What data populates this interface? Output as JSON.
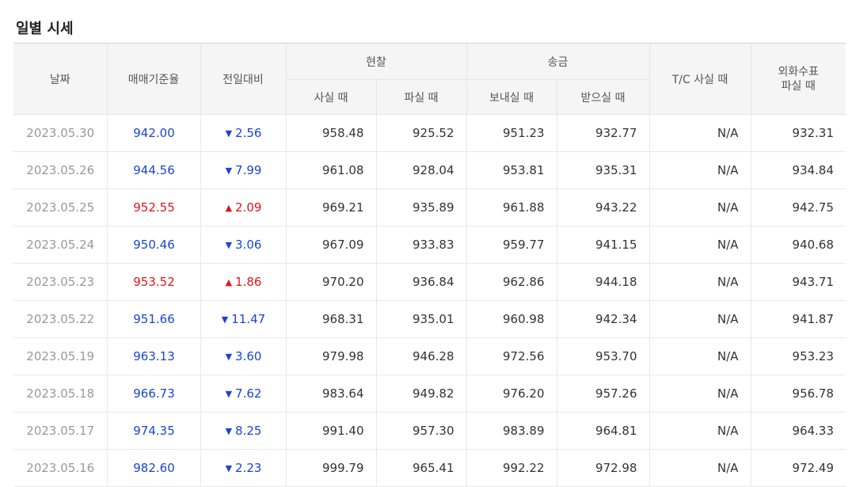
{
  "title": "일별 시세",
  "headers": {
    "date": "날짜",
    "base_rate": "매매기준율",
    "change": "전일대비",
    "cash": "현찰",
    "cash_buy": "사실 때",
    "cash_sell": "파실 때",
    "remit": "송금",
    "remit_send": "보내실 때",
    "remit_receive": "받으실 때",
    "tc_buy": "T/C 사실 때",
    "check_line1": "외화수표",
    "check_line2": "파실 때"
  },
  "colors": {
    "up": "#e3141b",
    "down": "#1a45d1"
  },
  "rows": [
    {
      "date": "2023.05.30",
      "base": "942.00",
      "dir": "down",
      "arrow": "▼",
      "change": "2.56",
      "cash_buy": "958.48",
      "cash_sell": "925.52",
      "send": "951.23",
      "receive": "932.77",
      "tc": "N/A",
      "check": "932.31"
    },
    {
      "date": "2023.05.26",
      "base": "944.56",
      "dir": "down",
      "arrow": "▼",
      "change": "7.99",
      "cash_buy": "961.08",
      "cash_sell": "928.04",
      "send": "953.81",
      "receive": "935.31",
      "tc": "N/A",
      "check": "934.84"
    },
    {
      "date": "2023.05.25",
      "base": "952.55",
      "dir": "up",
      "arrow": "▲",
      "change": "2.09",
      "cash_buy": "969.21",
      "cash_sell": "935.89",
      "send": "961.88",
      "receive": "943.22",
      "tc": "N/A",
      "check": "942.75"
    },
    {
      "date": "2023.05.24",
      "base": "950.46",
      "dir": "down",
      "arrow": "▼",
      "change": "3.06",
      "cash_buy": "967.09",
      "cash_sell": "933.83",
      "send": "959.77",
      "receive": "941.15",
      "tc": "N/A",
      "check": "940.68"
    },
    {
      "date": "2023.05.23",
      "base": "953.52",
      "dir": "up",
      "arrow": "▲",
      "change": "1.86",
      "cash_buy": "970.20",
      "cash_sell": "936.84",
      "send": "962.86",
      "receive": "944.18",
      "tc": "N/A",
      "check": "943.71"
    },
    {
      "date": "2023.05.22",
      "base": "951.66",
      "dir": "down",
      "arrow": "▼",
      "change": "11.47",
      "cash_buy": "968.31",
      "cash_sell": "935.01",
      "send": "960.98",
      "receive": "942.34",
      "tc": "N/A",
      "check": "941.87"
    },
    {
      "date": "2023.05.19",
      "base": "963.13",
      "dir": "down",
      "arrow": "▼",
      "change": "3.60",
      "cash_buy": "979.98",
      "cash_sell": "946.28",
      "send": "972.56",
      "receive": "953.70",
      "tc": "N/A",
      "check": "953.23"
    },
    {
      "date": "2023.05.18",
      "base": "966.73",
      "dir": "down",
      "arrow": "▼",
      "change": "7.62",
      "cash_buy": "983.64",
      "cash_sell": "949.82",
      "send": "976.20",
      "receive": "957.26",
      "tc": "N/A",
      "check": "956.78"
    },
    {
      "date": "2023.05.17",
      "base": "974.35",
      "dir": "down",
      "arrow": "▼",
      "change": "8.25",
      "cash_buy": "991.40",
      "cash_sell": "957.30",
      "send": "983.89",
      "receive": "964.81",
      "tc": "N/A",
      "check": "964.33"
    },
    {
      "date": "2023.05.16",
      "base": "982.60",
      "dir": "down",
      "arrow": "▼",
      "change": "2.23",
      "cash_buy": "999.79",
      "cash_sell": "965.41",
      "send": "992.22",
      "receive": "972.98",
      "tc": "N/A",
      "check": "972.49"
    }
  ]
}
